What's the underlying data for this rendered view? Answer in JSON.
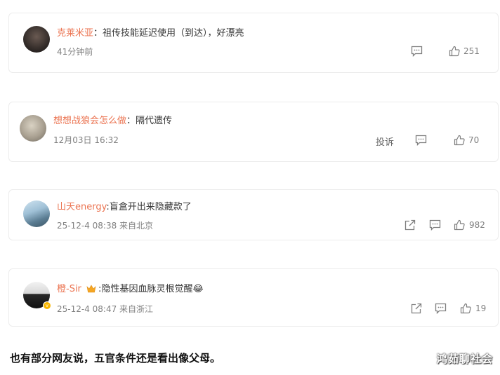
{
  "comments": [
    {
      "username": "克莱米亚",
      "separator": "：",
      "text": "祖传技能延迟使用（到达），好漂亮",
      "time": "41分钟前",
      "likes": "251"
    },
    {
      "username": "想想战狼会怎么做",
      "separator": "：",
      "text": "隔代遗传",
      "time": "12月03日 16:32",
      "report_label": "投诉",
      "likes": "70"
    },
    {
      "username": "山天energy",
      "separator": ":",
      "text": "盲盒开出来隐藏款了",
      "time": "25-12-4 08:38 来自北京",
      "likes": "982"
    },
    {
      "username": "橙-Sir",
      "separator": ":",
      "text": "隐性基因血脉灵根觉醒",
      "emoji": "😂",
      "time": "25-12-4 08:47 来自浙江",
      "likes": "19"
    }
  ],
  "footer_text": "也有部分网友说，五官条件还是看出像父母。",
  "watermark": "鸿茹聊社会",
  "colors": {
    "username": "#eb7350",
    "meta": "#808080",
    "border": "#ececec"
  },
  "icons": [
    "comment-icon",
    "like-icon",
    "share-icon",
    "crown-icon",
    "verified-icon"
  ]
}
